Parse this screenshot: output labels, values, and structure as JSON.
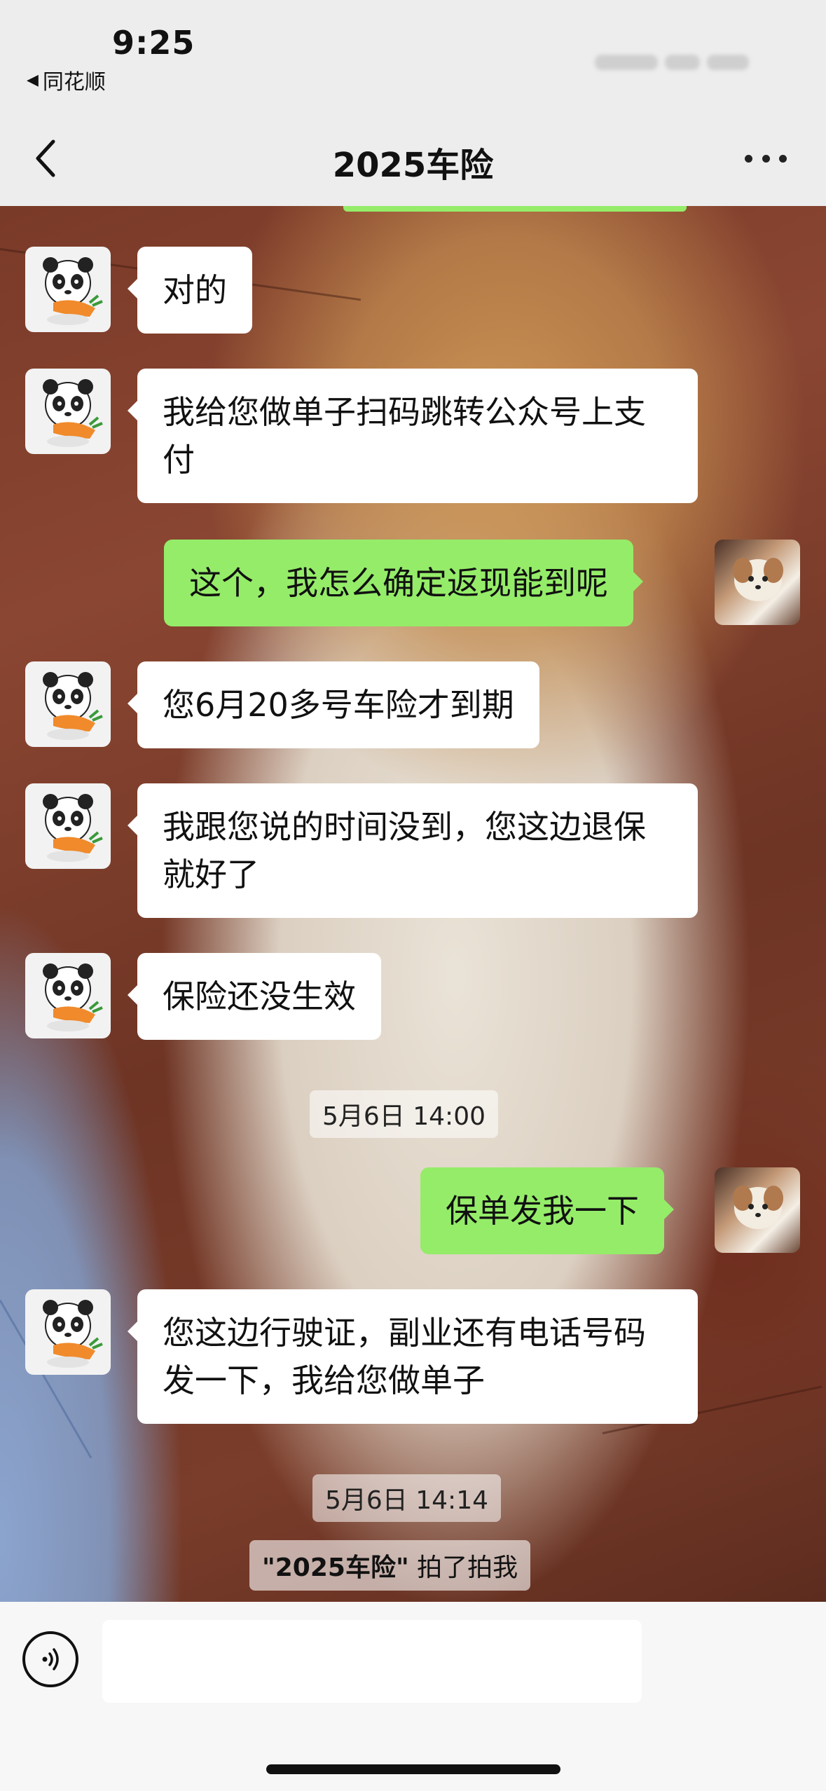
{
  "status_bar": {
    "time": "9:25",
    "back_app_label": "同花顺"
  },
  "nav": {
    "title": "2025车险"
  },
  "messages": [
    {
      "side": "left",
      "text": "对的"
    },
    {
      "side": "left",
      "text": "我给您做单子扫码跳转公众号上支付"
    },
    {
      "side": "right",
      "text": "这个，我怎么确定返现能到呢"
    },
    {
      "side": "left",
      "text": "您6月20多号车险才到期"
    },
    {
      "side": "left",
      "text": "我跟您说的时间没到，您这边退保就好了"
    },
    {
      "side": "left",
      "text": "保险还没生效"
    },
    {
      "side": "right",
      "text": "保单发我一下"
    },
    {
      "side": "left",
      "text": "您这边行驶证，副业还有电话号码发一下，我给您做单子"
    }
  ],
  "timestamps": [
    "5月6日 14:00",
    "5月6日 14:14"
  ],
  "system_message": {
    "name": "\"2025车险\"",
    "action": " 拍了拍我"
  },
  "colors": {
    "bubble_right": "#95ec69",
    "bubble_left": "#ffffff",
    "header_bg": "#ededed"
  },
  "icons": {
    "back": "chevron-left-icon",
    "more": "more-dots-icon",
    "voice": "voice-input-icon"
  }
}
